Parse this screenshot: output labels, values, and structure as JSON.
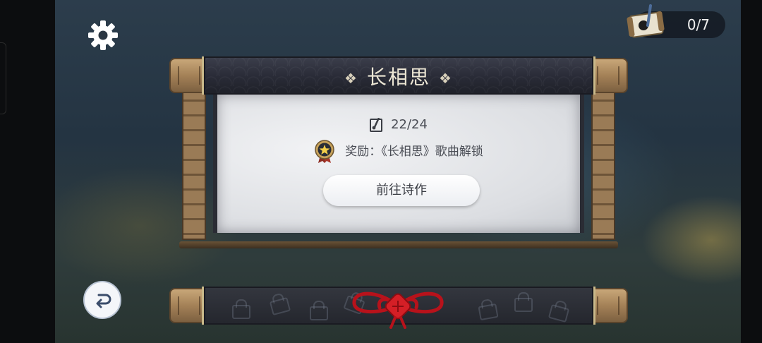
{
  "progress": {
    "value": "0/7",
    "icon": "poem-scroll-icon"
  },
  "settings": {
    "icon": "gear-icon"
  },
  "scroll": {
    "title": "长相思",
    "ornament": "❖",
    "count": "22/24",
    "count_icon": "brush-note-icon",
    "reward_icon": "star-medal-icon",
    "reward_text": "奖励：《长相思》歌曲解锁",
    "button_label": "前往诗作"
  },
  "bottom": {
    "knot_icon": "chinese-knot-icon",
    "pattern_icon": "lock-icon"
  },
  "back": {
    "icon": "return-arrow-icon"
  },
  "colors": {
    "paper": "#dcdee2",
    "roller": "#2a2c38",
    "wood": "#a48157",
    "knot": "#c0181f"
  }
}
